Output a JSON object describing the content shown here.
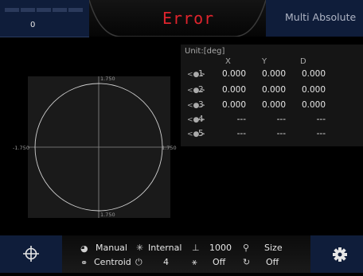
{
  "header": {
    "counter_value": "0",
    "title": "Error",
    "mode": "Multi Absolute"
  },
  "plot": {
    "label_top": "1.750",
    "label_bottom": "1.750",
    "label_left": "-1.750",
    "label_right": "1.750"
  },
  "table": {
    "unit": "Unit:[deg]",
    "columns": [
      "X",
      "Y",
      "D"
    ],
    "rows": [
      {
        "index": "1",
        "x": "0.000",
        "y": "0.000",
        "d": "0.000"
      },
      {
        "index": "2",
        "x": "0.000",
        "y": "0.000",
        "d": "0.000"
      },
      {
        "index": "3",
        "x": "0.000",
        "y": "0.000",
        "d": "0.000"
      },
      {
        "index": "4",
        "x": "---",
        "y": "---",
        "d": "---"
      },
      {
        "index": "5",
        "x": "---",
        "y": "---",
        "d": "---"
      }
    ]
  },
  "status": {
    "mode": "Manual",
    "light": "Internal",
    "exposure": "1000",
    "size_label": "Size",
    "method": "Centroid",
    "timer": "4",
    "filter": "Off",
    "size_value": "Off"
  },
  "colors": {
    "title": "#e0242d",
    "panel_blue": "#0f1d3a"
  }
}
